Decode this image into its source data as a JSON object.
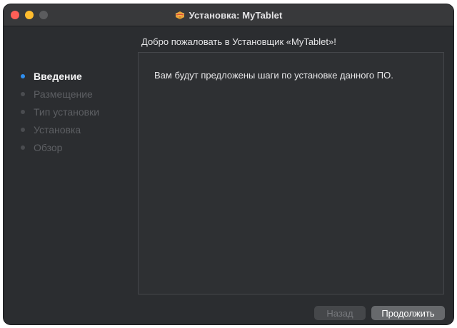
{
  "window": {
    "title": "Установка: MyTablet",
    "icon": "package-icon"
  },
  "heading": "Добро пожаловать в Установщик «MyTablet»!",
  "sidebar": {
    "steps": [
      {
        "label": "Введение",
        "active": true
      },
      {
        "label": "Размещение",
        "active": false
      },
      {
        "label": "Тип установки",
        "active": false
      },
      {
        "label": "Установка",
        "active": false
      },
      {
        "label": "Обзор",
        "active": false
      }
    ]
  },
  "content": {
    "text": "Вам будут предложены шаги по установке данного ПО."
  },
  "buttons": {
    "back_label": "Назад",
    "back_enabled": false,
    "continue_label": "Продолжить"
  },
  "colors": {
    "accent": "#2f8ff0",
    "close": "#fe5f57",
    "minimize": "#febc2e"
  }
}
